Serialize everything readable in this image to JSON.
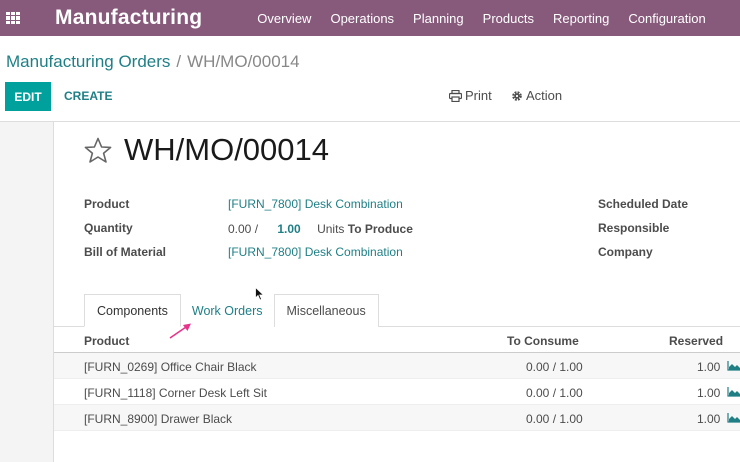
{
  "topbar": {
    "app_name": "Manufacturing",
    "menu": [
      "Overview",
      "Operations",
      "Planning",
      "Products",
      "Reporting",
      "Configuration"
    ]
  },
  "breadcrumb": {
    "parent": "Manufacturing Orders",
    "separator": "/",
    "current": "WH/MO/00014"
  },
  "toolbar": {
    "edit_label": "EDIT",
    "create_label": "CREATE",
    "print_label": "Print",
    "action_label": "Action"
  },
  "record": {
    "title": "WH/MO/00014",
    "fields": {
      "product_label": "Product",
      "product_value": "[FURN_7800] Desk Combination",
      "quantity_label": "Quantity",
      "quantity_produced": "0.00 /",
      "quantity_value": "1.00",
      "quantity_unit": "Units",
      "quantity_suffix": "To Produce",
      "bom_label": "Bill of Material",
      "bom_value": "[FURN_7800] Desk Combination",
      "scheduled_date_label": "Scheduled Date",
      "responsible_label": "Responsible",
      "company_label": "Company"
    }
  },
  "tabs": [
    "Components",
    "Work Orders",
    "Miscellaneous"
  ],
  "table": {
    "headers": [
      "Product",
      "To Consume",
      "Reserved"
    ],
    "rows": [
      {
        "product": "[FURN_0269] Office Chair Black",
        "to_consume": "0.00 / 1.00",
        "reserved": "1.00"
      },
      {
        "product": "[FURN_1118] Corner Desk Left Sit",
        "to_consume": "0.00 / 1.00",
        "reserved": "1.00"
      },
      {
        "product": "[FURN_8900] Drawer Black",
        "to_consume": "0.00 / 1.00",
        "reserved": "1.00"
      }
    ]
  },
  "colors": {
    "topbar": "#875a7b",
    "primary_button": "#00a09d",
    "link": "#1f7f85",
    "annotation_arrow": "#e8338a"
  },
  "icons": {
    "apps": "apps-grid-icon",
    "print": "printer-icon",
    "action": "gear-icon",
    "favorite": "star-outline-icon",
    "forecast": "area-chart-icon"
  }
}
